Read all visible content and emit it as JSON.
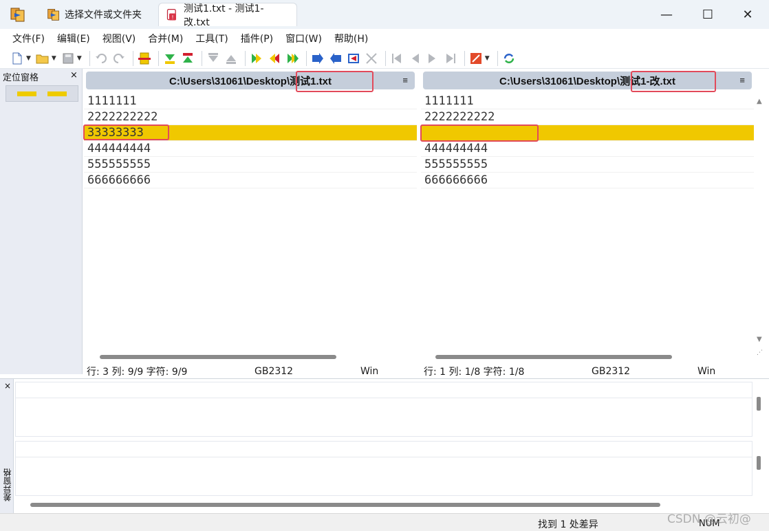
{
  "titlebar": {
    "tabs": [
      {
        "label": "选择文件或文件夹",
        "active": false
      },
      {
        "label": "测试1.txt - 测试1-改.txt",
        "active": true
      }
    ],
    "minimize": "—",
    "maximize": "☐",
    "close": "✕"
  },
  "menubar": {
    "items": [
      "文件(F)",
      "编辑(E)",
      "视图(V)",
      "合并(M)",
      "工具(T)",
      "插件(P)",
      "窗口(W)",
      "帮助(H)"
    ]
  },
  "location_pane": {
    "title": "定位窗格",
    "close": "×"
  },
  "left_pane": {
    "path": "C:\\Users\\31061\\Desktop\\测试1.txt",
    "lines": [
      "1111111",
      "2222222222",
      "33333333",
      "444444444",
      "555555555",
      "666666666"
    ],
    "diff_line_index": 2,
    "status": {
      "position": "行: 3  列: 9/9  字符: 9/9",
      "encoding": "GB2312",
      "eol": "Win"
    }
  },
  "right_pane": {
    "path": "C:\\Users\\31061\\Desktop\\测试1-改.txt",
    "lines": [
      "1111111",
      "2222222222",
      "",
      "444444444",
      "555555555",
      "666666666"
    ],
    "diff_line_index": 2,
    "status": {
      "position": "行: 1  列: 1/8  字符: 1/8",
      "encoding": "GB2312",
      "eol": "Win"
    }
  },
  "diff_pane": {
    "title": "差异窗格",
    "close": "×"
  },
  "statusbar": {
    "message": "找到 1 处差异",
    "num": "NUM"
  },
  "watermark": "CSDN @云初@",
  "colors": {
    "diff_highlight": "#f0c800",
    "annotation_box": "#e24a5a",
    "pane_header": "#c5cedb"
  }
}
